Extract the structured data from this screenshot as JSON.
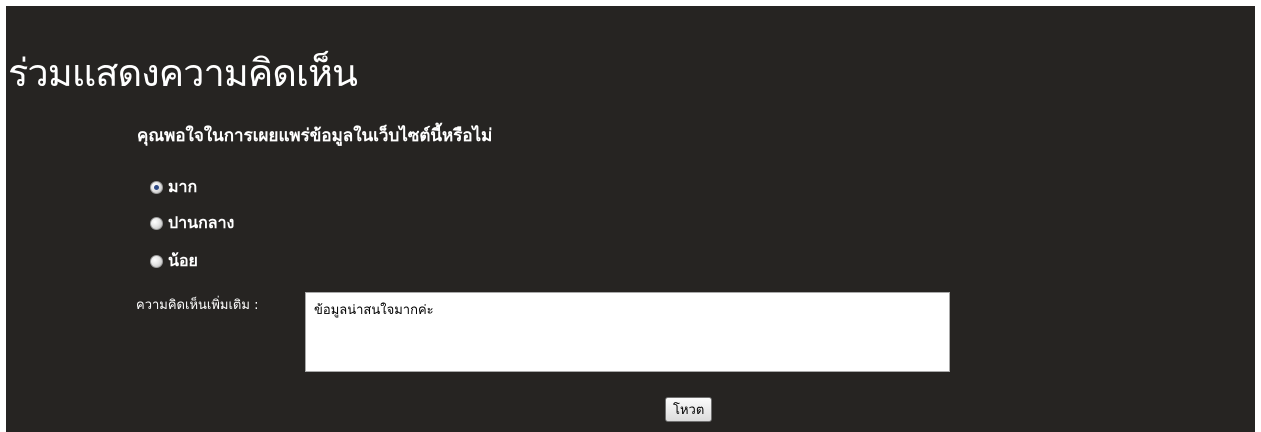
{
  "poll": {
    "title": "ร่วมแสดงความคิดเห็น",
    "question": "คุณพอใจในการเผยแพร่ข้อมูลในเว็บไซต์นี้หรือไม่",
    "options": [
      {
        "label": "มาก",
        "selected": true
      },
      {
        "label": "ปานกลาง",
        "selected": false
      },
      {
        "label": "น้อย",
        "selected": false
      }
    ],
    "comment_label": "ความคิดเห็นเพิ่มเติม :",
    "comment_value": "ข้อมูลน่าสนใจมากค่ะ",
    "submit_label": "โหวต"
  },
  "colors": {
    "panel_background": "#262422",
    "text": "#ffffff",
    "radio_dot": "#2e4a86"
  }
}
